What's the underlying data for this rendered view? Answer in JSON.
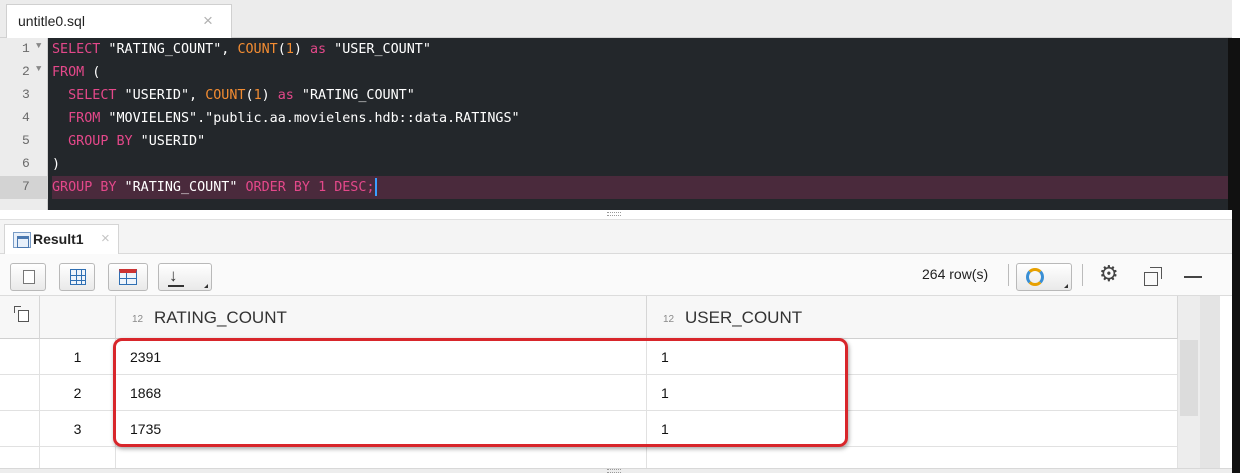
{
  "file_tab": {
    "title": "untitle0.sql",
    "close": "×"
  },
  "editor": {
    "lines": [
      {
        "n": "1",
        "fold": true
      },
      {
        "n": "2",
        "fold": true
      },
      {
        "n": "3",
        "fold": false
      },
      {
        "n": "4",
        "fold": false
      },
      {
        "n": "5",
        "fold": false
      },
      {
        "n": "6",
        "fold": false
      },
      {
        "n": "7",
        "fold": false
      }
    ],
    "code": {
      "l1": {
        "kw1": "SELECT",
        "t1": " \"RATING_COUNT\", ",
        "fn1": "COUNT",
        "p1": "(",
        "num1": "1",
        "p2": ")",
        "sp": " ",
        "kw2": "as",
        "t2": " \"USER_COUNT\""
      },
      "l2": {
        "kw1": "FROM",
        "t1": " ("
      },
      "l3": {
        "indent": "  ",
        "kw1": "SELECT",
        "t1": " \"USERID\", ",
        "fn1": "COUNT",
        "p1": "(",
        "num1": "1",
        "p2": ")",
        "sp": " ",
        "kw2": "as",
        "t2": " \"RATING_COUNT\""
      },
      "l4": {
        "indent": "  ",
        "kw1": "FROM",
        "t1": " \"MOVIELENS\".\"public.aa.movielens.hdb::data.RATINGS\""
      },
      "l5": {
        "indent": "  ",
        "kw1": "GROUP BY",
        "t1": " \"USERID\""
      },
      "l6": {
        "t1": ")"
      },
      "l7": {
        "kw1": "GROUP BY",
        "t1": " \"RATING_COUNT\" ",
        "kw2": "ORDER BY",
        "sp": " ",
        "num1": "1",
        "sp2": " ",
        "kw3": "DESC",
        "t2": ";"
      }
    }
  },
  "result_tab": {
    "label": "Result1",
    "close": "×"
  },
  "toolbar": {
    "row_count": "264 row(s)"
  },
  "table": {
    "columns": [
      {
        "type": "12",
        "name": "RATING_COUNT"
      },
      {
        "type": "12",
        "name": "USER_COUNT"
      }
    ],
    "rows": [
      {
        "num": "1",
        "rating_count": "2391",
        "user_count": "1"
      },
      {
        "num": "2",
        "rating_count": "1868",
        "user_count": "1"
      },
      {
        "num": "3",
        "rating_count": "1735",
        "user_count": "1"
      }
    ]
  },
  "colors": {
    "keyword": "#e4488a",
    "function": "#f28c32",
    "editor_bg": "#23272b",
    "highlight": "#d8262b"
  }
}
